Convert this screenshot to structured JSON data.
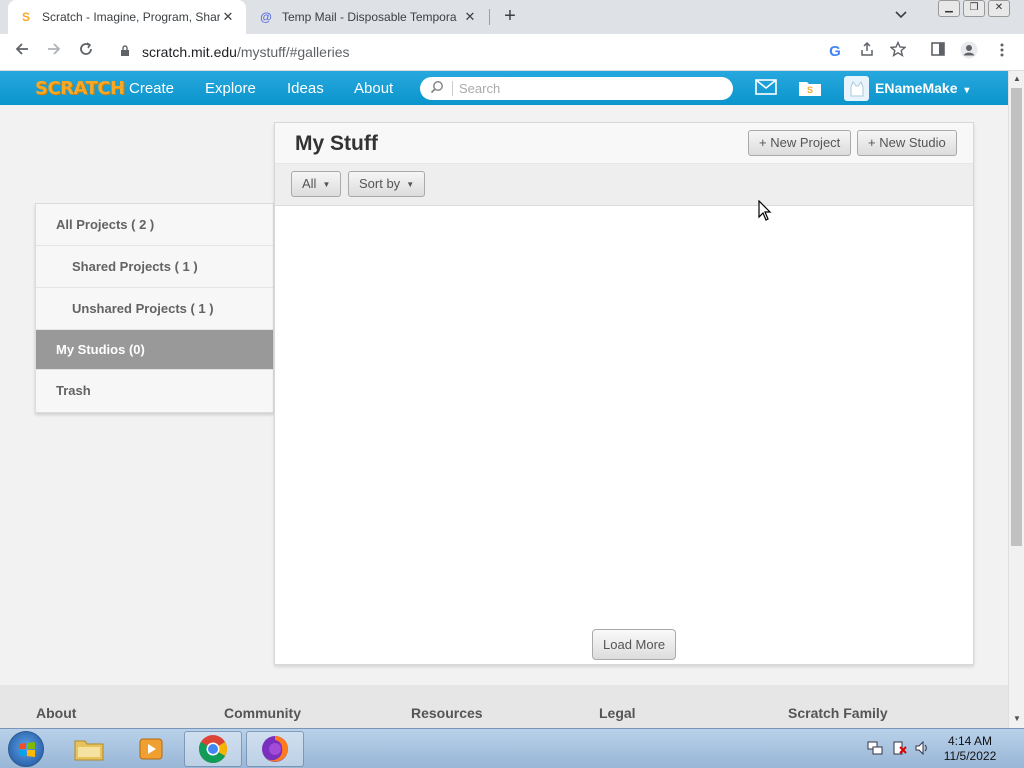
{
  "browser": {
    "tabs": [
      {
        "title": "Scratch - Imagine, Program, Shar",
        "favicon": "scratch-cat-icon",
        "close": "✕"
      },
      {
        "title": "Temp Mail - Disposable Tempora",
        "favicon": "at-sign-icon",
        "close": "✕"
      }
    ],
    "new_tab": "+",
    "tab_menu": "⌄",
    "url_host": "scratch.mit.edu",
    "url_path": "/mystuff/#galleries"
  },
  "scratch_nav": {
    "logo": "SCRATCH",
    "links": [
      "Create",
      "Explore",
      "Ideas",
      "About"
    ],
    "search_placeholder": "Search",
    "username": "ENameMake",
    "username_caret": "▾"
  },
  "sidebar": {
    "items": [
      {
        "label": "All Projects ( 2 )"
      },
      {
        "label": "Shared Projects ( 1 )"
      },
      {
        "label": "Unshared Projects ( 1 )"
      },
      {
        "label": "My Studios (0)"
      },
      {
        "label": "Trash"
      }
    ]
  },
  "main": {
    "title": "My Stuff",
    "new_project": "+ New Project",
    "new_studio": "+ New Studio",
    "filter_all": "All",
    "sort_by": "Sort by",
    "load_more": "Load More"
  },
  "footer": {
    "columns": [
      "About",
      "Community",
      "Resources",
      "Legal",
      "Scratch Family"
    ]
  },
  "taskbar": {
    "time": "4:14 AM",
    "date": "11/5/2022"
  },
  "colors": {
    "nav_blue": "#0c9fd6",
    "active_sidebar": "#999999"
  }
}
